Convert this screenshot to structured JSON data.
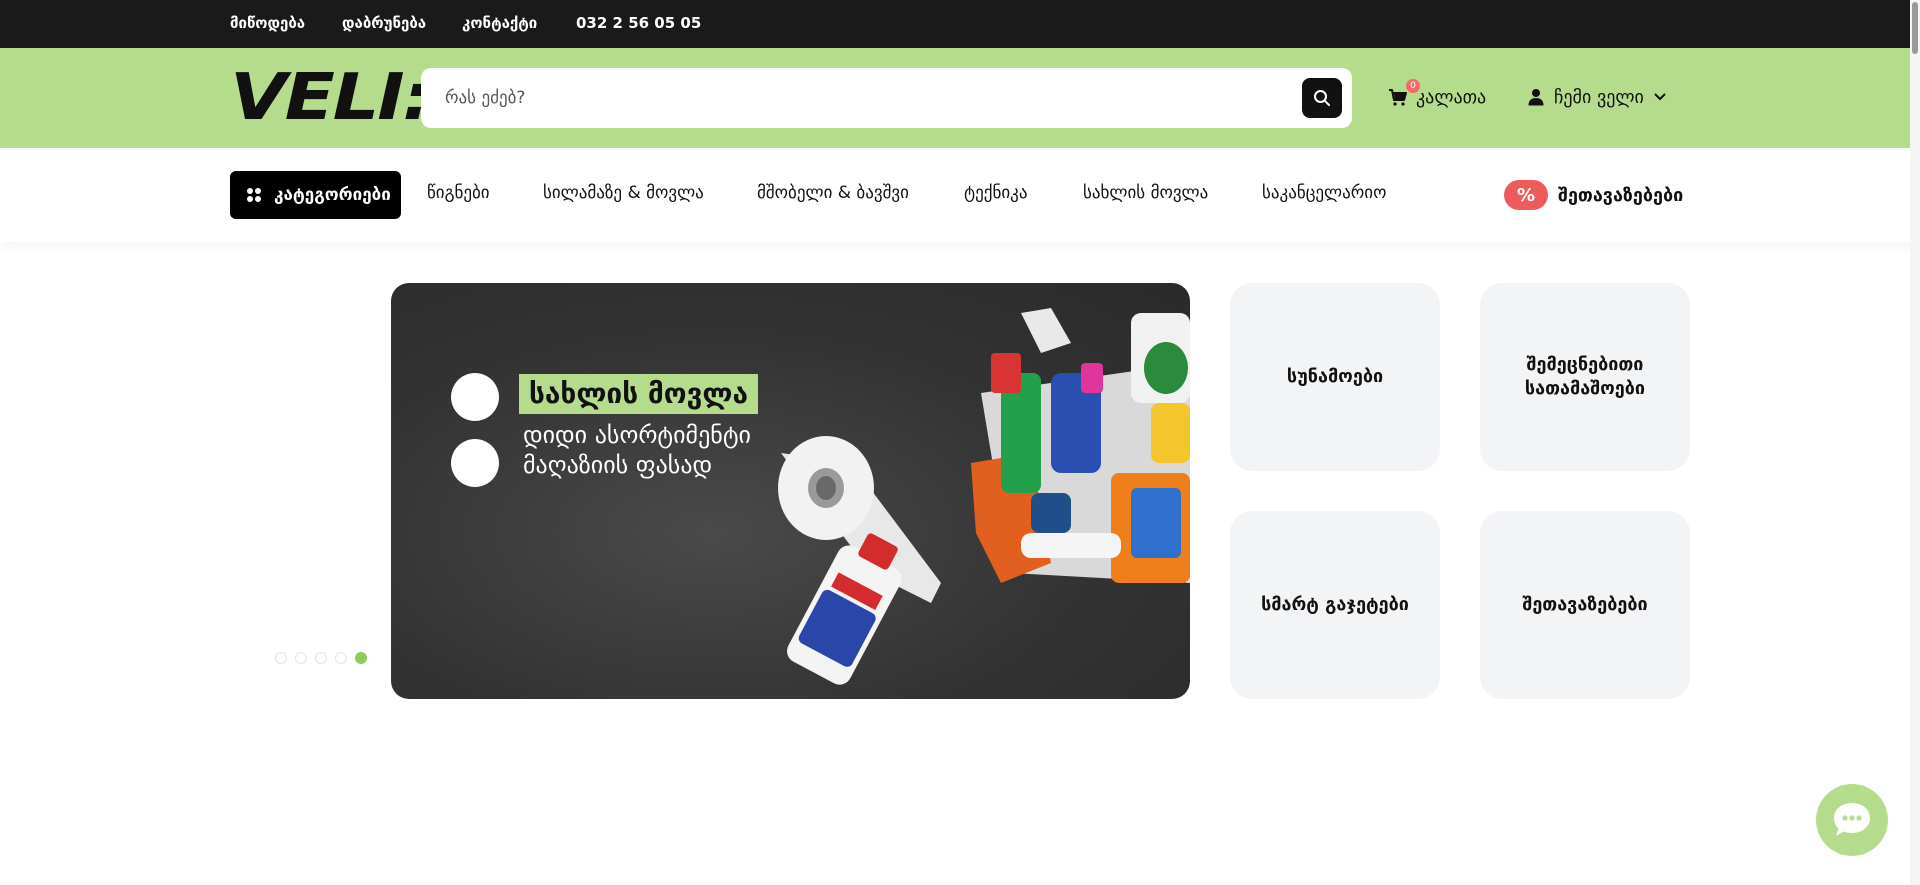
{
  "topbar": {
    "links": [
      "მიწოდება",
      "დაბრუნება",
      "კონტაქტი"
    ],
    "phone": "032 2 56 05 05"
  },
  "header": {
    "logo_text": "VELI:",
    "search": {
      "placeholder": "რას ეძებ?",
      "value": ""
    },
    "cart": {
      "label": "კალათა",
      "count": "0"
    },
    "account": {
      "label": "ჩემი ველი"
    }
  },
  "nav": {
    "categories_label": "კატეგორიები",
    "links": [
      "წიგნები",
      "სილამაზე & მოვლა",
      "მშობელი & ბავშვი",
      "ტექნიკა",
      "სახლის მოვლა",
      "საკანცელარიო"
    ],
    "promo": {
      "badge": "%",
      "label": "შეთავაზებები"
    }
  },
  "slider": {
    "dot_count": 5,
    "active_index": 4,
    "banner": {
      "title": "სახლის მოვლა",
      "lines": [
        "დიდი ასორტიმენტი",
        "მაღაზიის ფასად"
      ]
    }
  },
  "tiles": [
    {
      "label": "სუნამოები"
    },
    {
      "label": "შემეცნებითი სათამაშოები"
    },
    {
      "label": "სმარტ გაჯეტები"
    },
    {
      "label": "შეთავაზებები"
    }
  ],
  "colors": {
    "brand_green": "#b5dc8c",
    "topbar": "#1a1a1a",
    "promo_red": "#ef5b5b",
    "tile_bg": "#f3f4f6"
  },
  "icons": {
    "search": "search-icon",
    "cart": "cart-icon",
    "account": "user-icon",
    "dropdown": "chevron-down-icon",
    "categories": "grid-icon",
    "chat": "chat-icon"
  }
}
